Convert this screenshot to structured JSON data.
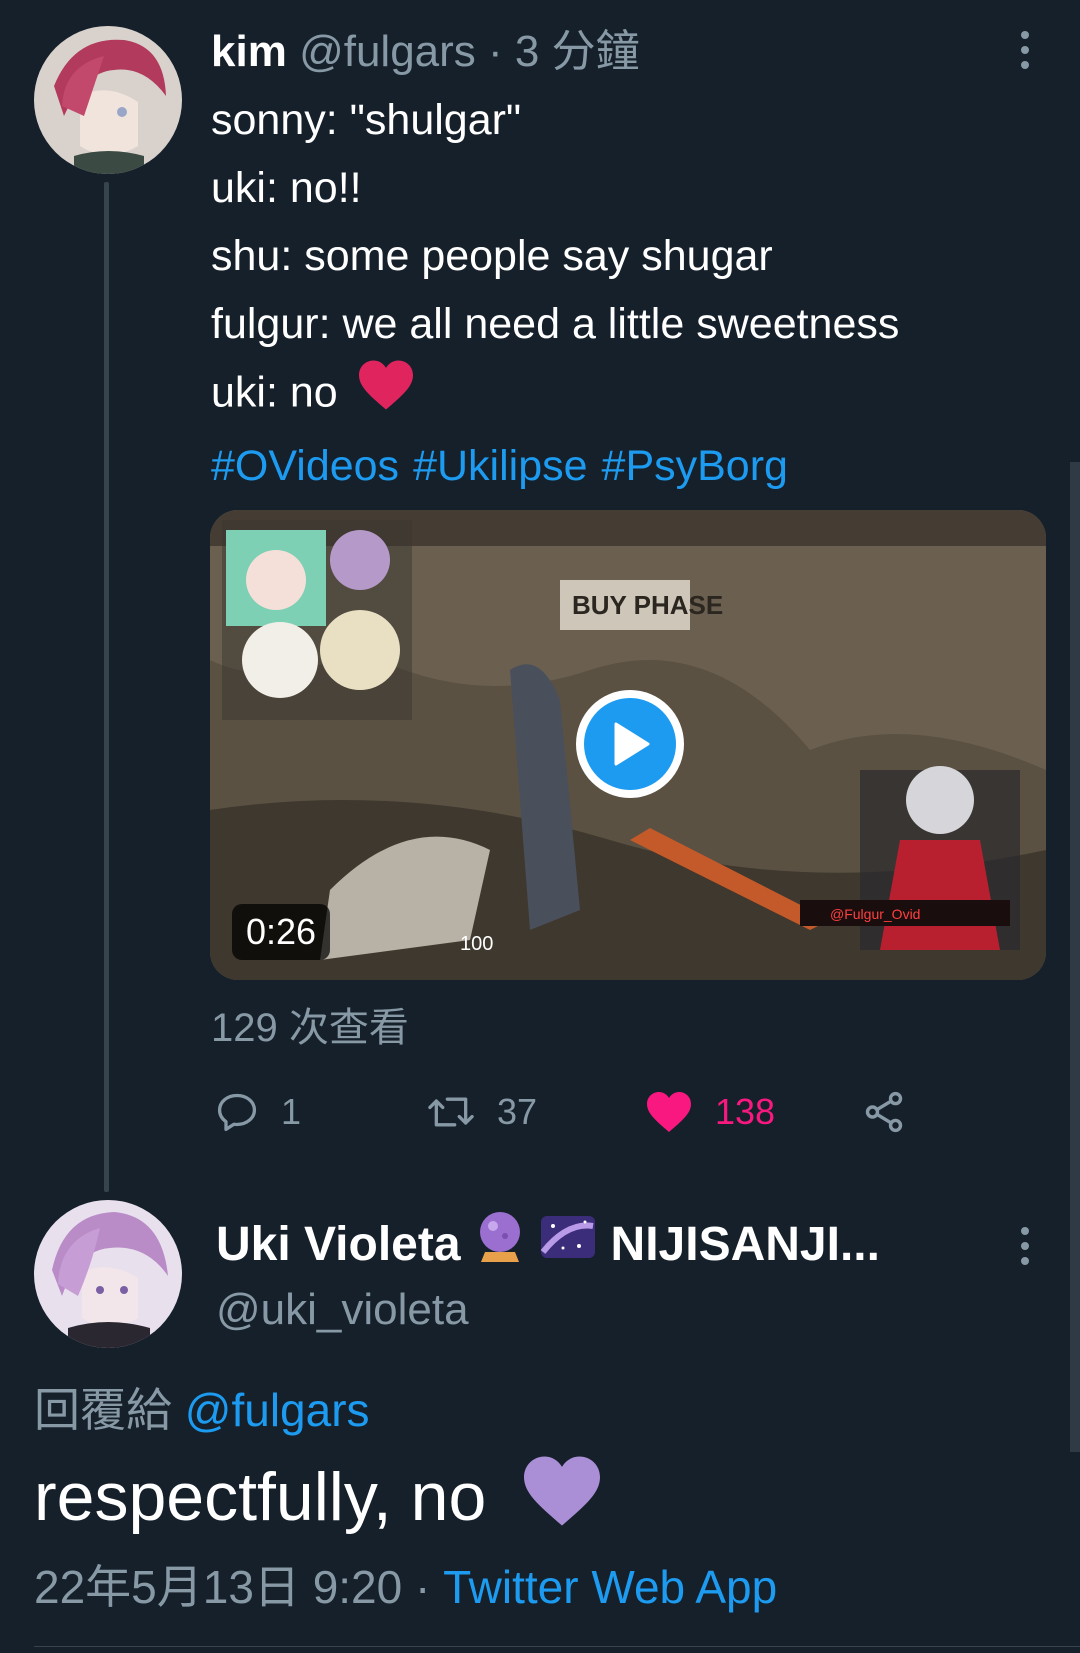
{
  "tweet1": {
    "author_name": "kim",
    "handle": "@fulgars",
    "separator": "·",
    "time": "3 分鐘",
    "lines": [
      "sonny: \"shulgar\"",
      "uki: no!!",
      "shu: some people say shugar",
      "fulgur: we all need a little sweetness",
      "uki: no"
    ],
    "hashtags": [
      "#OVideos",
      "#Ukilipse",
      "#PsyBorg"
    ],
    "video": {
      "duration": "0:26",
      "overlay_text": "BUY PHASE",
      "hud_ammo": "100",
      "streamer_tag": "@Fulgur_Ovid"
    },
    "views": "129 次查看",
    "actions": {
      "reply_count": "1",
      "retweet_count": "37",
      "like_count": "138"
    }
  },
  "tweet2": {
    "author_name": "Uki Violeta",
    "name_suffix": "NIJISANJI...",
    "name_emojis": [
      "crystal-ball-icon",
      "milky-way-icon"
    ],
    "handle": "@uki_violeta",
    "replying_prefix": "回覆給",
    "replying_to": "@fulgars",
    "text": "respectfully, no",
    "date": "22年5月13日 9:20",
    "separator": "·",
    "client": "Twitter Web App"
  },
  "colors": {
    "background": "#15202b",
    "accent": "#1d9bf0",
    "muted": "#8899a6",
    "like": "#f91880",
    "heart_red": "#e0245e",
    "heart_purple": "#aa8ed6"
  }
}
